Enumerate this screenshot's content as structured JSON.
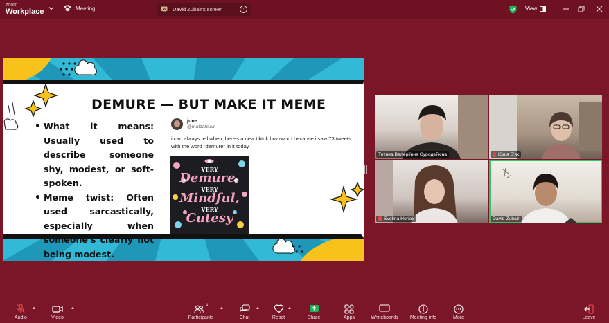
{
  "app": {
    "brand_top": "zoom",
    "brand_bottom": "Workplace",
    "meeting_label": "Meeting",
    "share_label": "David Zubair's screen",
    "view_label": "View"
  },
  "slide": {
    "title": "DEMURE — BUT MAKE IT MEME",
    "bullets": [
      "What it means: Usually used to describe someone shy, modest, or soft-spoken.",
      "Meme twist: Often used sarcastically, especially when someone's clearly not being modest."
    ],
    "tweet": {
      "name": "june",
      "handle": "@matzahluvr",
      "text": "i can always tell when there's a new tiktok buzzword because i saw 73 tweets with the word \"demure\" in it today"
    },
    "meme": {
      "line1": "VERY",
      "line2": "Demure,",
      "line3": "VERY",
      "line4": "Mindful,",
      "line5": "VERY",
      "line6": "Cutesy"
    }
  },
  "participants": [
    {
      "name": "Тетяна Валеріївна Суродейкіна",
      "muted": false
    },
    {
      "name": "Юлія Б'яс",
      "muted": true
    },
    {
      "name": "Evelina Horiak",
      "muted": true
    },
    {
      "name": "David Zubair",
      "muted": false,
      "active": true
    }
  ],
  "toolbar": {
    "audio": "Audio",
    "video": "Video",
    "participants": "Participants",
    "participants_count": "4",
    "chat": "Chat",
    "react": "React",
    "share": "Share",
    "apps": "Apps",
    "whiteboards": "Whiteboards",
    "meeting_info": "Meeting info",
    "more": "More",
    "leave": "Leave"
  },
  "colors": {
    "background": "#7a1628",
    "topbar": "#6e1223",
    "share_green": "#1fb25a",
    "active_tile": "#33c36b",
    "muted_red": "#e0474c",
    "slide_cyan": "#32b9d6",
    "slide_yellow": "#f7c21b"
  }
}
